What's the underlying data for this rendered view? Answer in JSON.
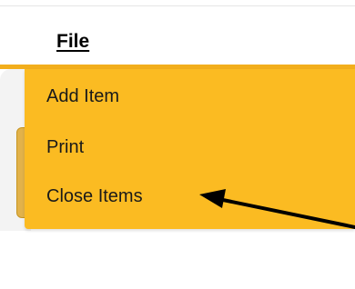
{
  "menubar": {
    "file_label": "File"
  },
  "file_menu": {
    "items": [
      {
        "label": "Add Item"
      },
      {
        "label": "Print"
      },
      {
        "label": "Close Items"
      }
    ]
  },
  "colors": {
    "menu_background": "#fbbb22",
    "menubar_edge": "#f2ae1c",
    "arrow": "#000000"
  },
  "annotation": {
    "icon": "arrow-pointer",
    "points_to": "Close Items"
  }
}
